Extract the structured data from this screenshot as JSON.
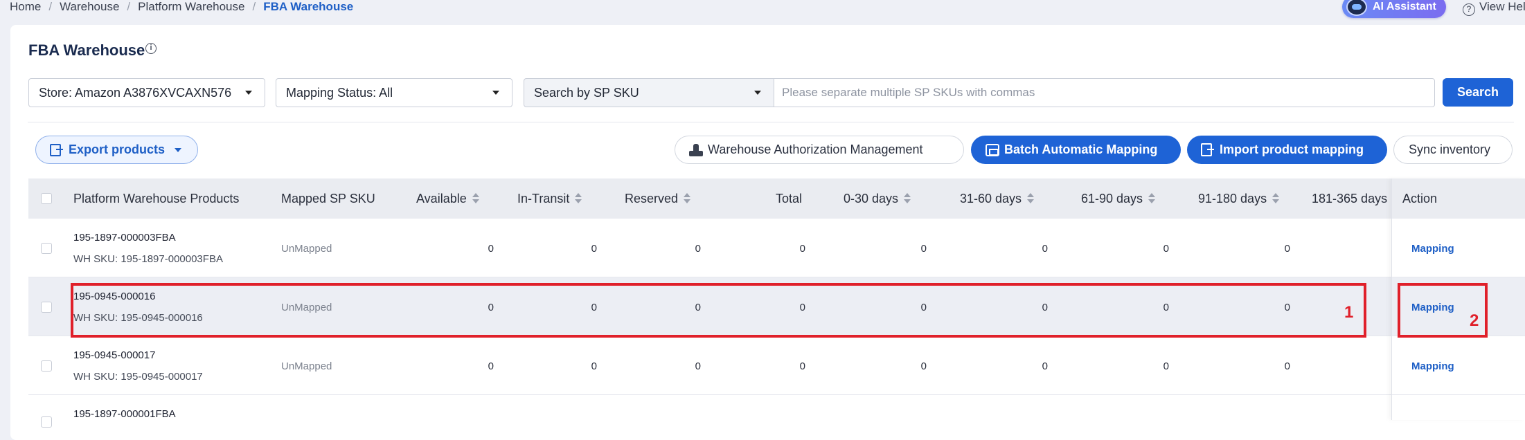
{
  "breadcrumb": [
    "Home",
    "Warehouse",
    "Platform Warehouse",
    "FBA Warehouse"
  ],
  "ai_assistant_label": "AI Assistant",
  "help_label": "View Hel",
  "page_title": "FBA Warehouse",
  "filters": {
    "store": "Store: Amazon A3876XVCAXN576",
    "mapping_status": "Mapping Status: All",
    "search_type": "Search by SP SKU",
    "search_placeholder": "Please separate multiple SP SKUs with commas",
    "search_button": "Search"
  },
  "toolbar": {
    "export": "Export products",
    "warehouse_auth": "Warehouse Authorization Management",
    "batch_mapping": "Batch Automatic Mapping",
    "import_mapping": "Import product mapping",
    "sync": "Sync inventory"
  },
  "columns": [
    "Platform Warehouse Products",
    "Mapped SP SKU",
    "Available",
    "In-Transit",
    "Reserved",
    "Total",
    "0-30 days",
    "31-60 days",
    "61-90 days",
    "91-180 days",
    "181-365 days",
    "Action"
  ],
  "rows": [
    {
      "name": "195-1897-000003FBA",
      "wh_sku": "WH SKU: 195-1897-000003FBA",
      "mapped": "UnMapped",
      "values": [
        "0",
        "0",
        "0",
        "0",
        "0",
        "0",
        "0",
        "0"
      ],
      "action": "Mapping"
    },
    {
      "name": "195-0945-000016",
      "wh_sku": "WH SKU: 195-0945-000016",
      "mapped": "UnMapped",
      "values": [
        "0",
        "0",
        "0",
        "0",
        "0",
        "0",
        "0",
        "0"
      ],
      "action": "Mapping"
    },
    {
      "name": "195-0945-000017",
      "wh_sku": "WH SKU: 195-0945-000017",
      "mapped": "UnMapped",
      "values": [
        "0",
        "0",
        "0",
        "0",
        "0",
        "0",
        "0",
        "0"
      ],
      "action": "Mapping"
    },
    {
      "name": "195-1897-000001FBA"
    }
  ],
  "annotations": [
    "1",
    "2"
  ],
  "colors": {
    "primary": "#1e63d6",
    "highlight": "#e0202a",
    "row_selected": "#eceef4"
  }
}
